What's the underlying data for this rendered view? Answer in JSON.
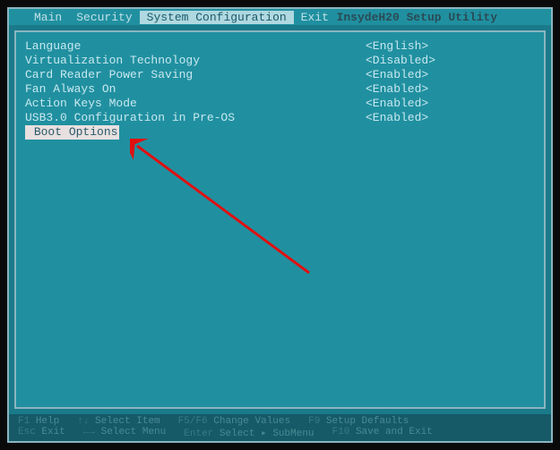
{
  "title": "InsydeH20 Setup Utility",
  "tabs": [
    {
      "label": "Main",
      "active": false
    },
    {
      "label": "Security",
      "active": false
    },
    {
      "label": "System Configuration",
      "active": true
    },
    {
      "label": "Exit",
      "active": false
    }
  ],
  "settings": [
    {
      "label": "Language",
      "value": "<English>"
    },
    {
      "label": "Virtualization Technology",
      "value": "<Disabled>"
    },
    {
      "label": "Card Reader Power Saving",
      "value": "<Enabled>"
    },
    {
      "label": "Fan Always On",
      "value": "<Enabled>"
    },
    {
      "label": "Action Keys Mode",
      "value": "<Enabled>"
    },
    {
      "label": "USB3.0 Configuration in Pre-OS",
      "value": "<Enabled>"
    }
  ],
  "selected_item": {
    "marker": "▸",
    "label": "Boot Options"
  },
  "footer": {
    "row1": [
      {
        "key": "F1",
        "action": "Help"
      },
      {
        "key": "↑↓",
        "action": "Select Item"
      },
      {
        "key": "F5/F6",
        "action": "Change Values"
      },
      {
        "key": "F9",
        "action": "Setup Defaults"
      }
    ],
    "row2": [
      {
        "key": "Esc",
        "action": "Exit"
      },
      {
        "key": "←→",
        "action": "Select Menu"
      },
      {
        "key": "Enter",
        "action": "Select ▸ SubMenu"
      },
      {
        "key": "F10",
        "action": "Save and Exit"
      }
    ]
  }
}
